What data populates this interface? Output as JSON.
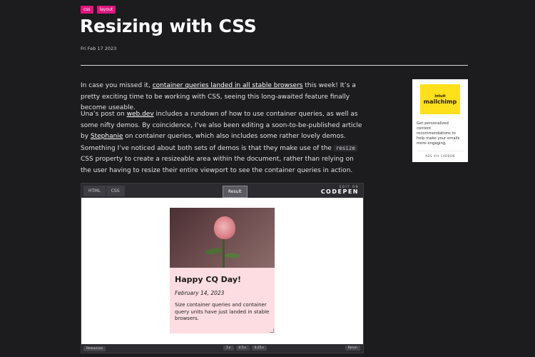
{
  "tags": [
    "css",
    "layout"
  ],
  "title": "Resizing with CSS",
  "date": "Fri Feb 17 2023",
  "paragraph1": {
    "before": "In case you missed it, ",
    "link": "container queries landed in all stable browsers",
    "after": " this week! It’s a pretty exciting time to be working with CSS, seeing this long-awaited feature finally become useable."
  },
  "paragraph2": {
    "before": "Una’s post on ",
    "link1": "web.dev",
    "mid1": " includes a rundown of how to use container queries, as well as some nifty demos. By coincidence, I’ve also been editing a soon-to-be-published article by ",
    "link2": "Stephanie",
    "mid2": " on container queries, which also includes some rather lovely demos. Something I’ve noticed about both sets of demos is that they make use of the ",
    "code": "resize",
    "after": " CSS property to create a resizeable area within the document, rather than relying on the user having to resize their entire viewport to see the container queries in action."
  },
  "ad": {
    "logo_small": "intuit",
    "logo": "mailchimp",
    "text": "Get personalized content recommendations to help make your emails more engaging.",
    "via": "ADS VIA CARBON"
  },
  "codepen": {
    "tab_html": "HTML",
    "tab_css": "CSS",
    "result": "Result",
    "edit_on": "EDIT ON",
    "brand": "CODEPEN",
    "card_title": "Happy CQ Day!",
    "card_date": "February 14, 2023",
    "card_text": "Size container queries and container query units have just landed in stable browsers.",
    "resources": "Resources",
    "zoom": [
      "1×",
      "0.5×",
      "0.25×"
    ],
    "rerun": "Rerun"
  }
}
